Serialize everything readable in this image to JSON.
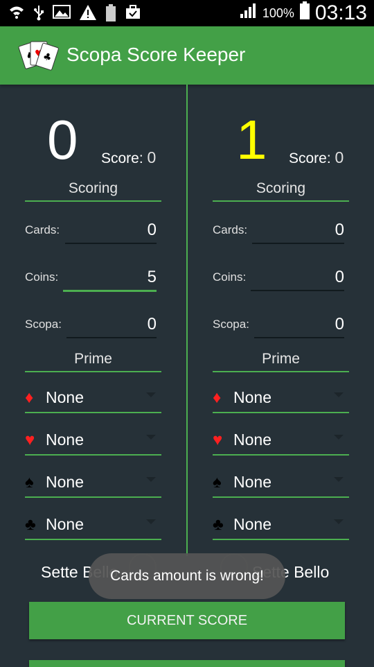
{
  "status_bar": {
    "icons": [
      "wifi-icon",
      "usb-icon",
      "image-icon",
      "warning-icon",
      "battery-saver-icon",
      "bag-check-icon"
    ],
    "battery_percent": "100%",
    "time": "03:13"
  },
  "app": {
    "title": "Scopa Score Keeper"
  },
  "players": [
    {
      "big_score": "0",
      "big_score_color": "#ffffff",
      "score_label": "Score:",
      "score_value": "0",
      "scoring_header": "Scoring",
      "cards_label": "Cards:",
      "cards_value": "0",
      "coins_label": "Coins:",
      "coins_value": "5",
      "scopa_label": "Scopa:",
      "scopa_value": "0",
      "prime_header": "Prime",
      "primes": [
        "None",
        "None",
        "None",
        "None"
      ],
      "sette_bello": "Sette Bello"
    },
    {
      "big_score": "1",
      "big_score_color": "#ffff00",
      "score_label": "Score:",
      "score_value": "0",
      "scoring_header": "Scoring",
      "cards_label": "Cards:",
      "cards_value": "0",
      "coins_label": "Coins:",
      "coins_value": "0",
      "scopa_label": "Scopa:",
      "scopa_value": "0",
      "prime_header": "Prime",
      "primes": [
        "None",
        "None",
        "None",
        "None"
      ],
      "sette_bello": "Sette Bello"
    }
  ],
  "suits": [
    {
      "name": "diamond-icon",
      "glyph": "♦",
      "color": "#ff2020"
    },
    {
      "name": "heart-icon",
      "glyph": "♥",
      "color": "#ff2020"
    },
    {
      "name": "spade-icon",
      "glyph": "♠",
      "color": "#000000"
    },
    {
      "name": "club-icon",
      "glyph": "♣",
      "color": "#000000"
    }
  ],
  "buttons": {
    "current_score": "CURRENT SCORE"
  },
  "toast": {
    "message": "Cards amount is wrong!"
  },
  "colors": {
    "accent": "#43a047",
    "background": "#263138"
  }
}
